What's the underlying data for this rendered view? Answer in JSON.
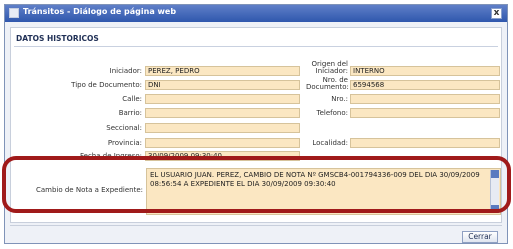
{
  "window": {
    "title": "Tránsitos - Diálogo de página web",
    "close_glyph": "x"
  },
  "section": {
    "title": "DATOS HISTORICOS"
  },
  "fields": {
    "iniciador": {
      "label": "Iniciador:",
      "value": "PEREZ, PEDRO"
    },
    "origen": {
      "label": "Origen del Iniciador:",
      "value": "INTERNO"
    },
    "tipo_documento": {
      "label": "Tipo de Documento:",
      "value": "DNI"
    },
    "nro_documento": {
      "label": "Nro. de Documento:",
      "value": "6594568"
    },
    "calle": {
      "label": "Calle:",
      "value": ""
    },
    "nro": {
      "label": "Nro.:",
      "value": ""
    },
    "barrio": {
      "label": "Barrio:",
      "value": ""
    },
    "telefono": {
      "label": "Telefono:",
      "value": ""
    },
    "seccional": {
      "label": "Seccional:",
      "value": ""
    },
    "provincia": {
      "label": "Provincia:",
      "value": ""
    },
    "localidad": {
      "label": "Localidad:",
      "value": ""
    },
    "fecha_ingreso": {
      "label": "Fecha de Ingreso:",
      "value": "30/09/2009 09:30:40"
    }
  },
  "note": {
    "label": "Cambio de Nota a Expediente:",
    "value": "EL USUARIO JUAN. PEREZ, CAMBIO DE NOTA Nº GMSCB4-001794336-009 DEL DIA 30/09/2009 08:56:54 A EXPEDIENTE EL DIA 30/09/2009 09:30:40"
  },
  "footer": {
    "close_label": "Cerrar"
  },
  "colors": {
    "field_bg": "#fbe7c2",
    "highlight": "#a01a1a",
    "titlebar": "#2f57ad"
  }
}
